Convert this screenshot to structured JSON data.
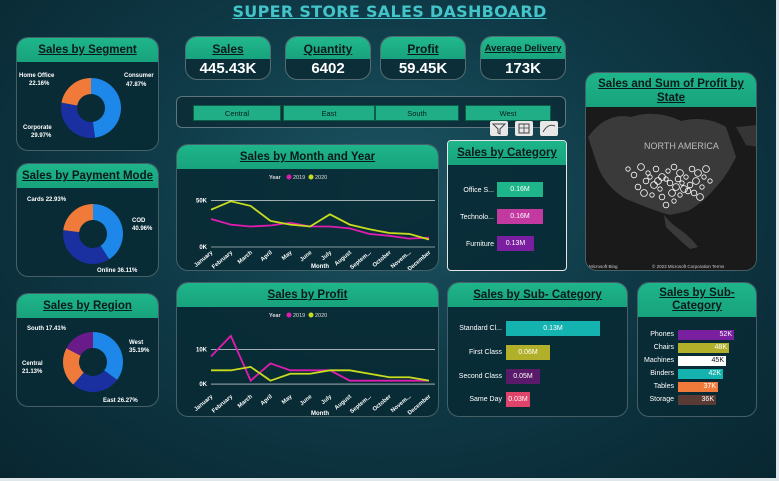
{
  "title": "SUPER STORE SALES DASHBOARD",
  "kpis": [
    {
      "label": "Sales",
      "value": "445.43K"
    },
    {
      "label": "Quantity",
      "value": "6402"
    },
    {
      "label": "Profit",
      "value": "59.45K"
    },
    {
      "label": "Average Delivery",
      "value": "173K"
    }
  ],
  "regions_slicer": [
    "Central",
    "East",
    "South",
    "West"
  ],
  "segment": {
    "title": "Sales by Segment",
    "slices": [
      {
        "name": "Consumer",
        "pct": "47.87%",
        "value": 47.87,
        "color": "#1e88ea"
      },
      {
        "name": "Corporate",
        "pct": "29.97%",
        "value": 29.97,
        "color": "#1a2fa0"
      },
      {
        "name": "Home Office",
        "pct": "22.16%",
        "value": 22.16,
        "color": "#f07a3a"
      }
    ]
  },
  "payment": {
    "title": "Sales by Payment Mode",
    "slices": [
      {
        "name": "COD",
        "pct": "40.96%",
        "value": 40.96,
        "color": "#1e88ea"
      },
      {
        "name": "Online",
        "pct": "36.11%",
        "value": 36.11,
        "color": "#1a2fa0"
      },
      {
        "name": "Cards",
        "pct": "22.93%",
        "value": 22.93,
        "color": "#f07a3a"
      }
    ]
  },
  "region": {
    "title": "Sales by Region",
    "slices": [
      {
        "name": "West",
        "pct": "35.19%",
        "value": 35.19,
        "color": "#1e88ea"
      },
      {
        "name": "East",
        "pct": "26.27%",
        "value": 26.27,
        "color": "#1a2fa0"
      },
      {
        "name": "Central",
        "pct": "21.13%",
        "value": 21.13,
        "color": "#f07a3a"
      },
      {
        "name": "South",
        "pct": "17.41%",
        "value": 17.41,
        "color": "#6a1b8a"
      }
    ]
  },
  "month_chart": {
    "title": "Sales by Month and Year",
    "xlabel": "Month",
    "legend_title": "Year",
    "ticks": [
      "0K",
      "50K"
    ]
  },
  "profit_chart": {
    "title": "Sales by Profit",
    "xlabel": "Month",
    "legend_title": "Year",
    "ticks": [
      "0K",
      "10K"
    ]
  },
  "chart_data": [
    {
      "type": "line",
      "title": "Sales by Month and Year",
      "xlabel": "Month",
      "categories": [
        "January",
        "February",
        "March",
        "April",
        "May",
        "June",
        "July",
        "August",
        "Septem...",
        "October",
        "Novem...",
        "December"
      ],
      "series": [
        {
          "name": "2019",
          "color": "#e01cb0",
          "values": [
            30,
            24,
            22,
            23,
            26,
            22,
            22,
            20,
            14,
            12,
            9,
            10
          ]
        },
        {
          "name": "2020",
          "color": "#c8dc1e",
          "values": [
            40,
            49,
            44,
            28,
            24,
            22,
            35,
            24,
            19,
            15,
            14,
            8
          ]
        }
      ],
      "ylim": [
        0,
        60
      ]
    },
    {
      "type": "line",
      "title": "Sales by Profit",
      "xlabel": "Month",
      "categories": [
        "January",
        "February",
        "March",
        "April",
        "May",
        "June",
        "July",
        "August",
        "Septem...",
        "October",
        "Novem...",
        "December"
      ],
      "series": [
        {
          "name": "2019",
          "color": "#e01cb0",
          "values": [
            8,
            14,
            1,
            6,
            4,
            4,
            4,
            1,
            1,
            1,
            1,
            1
          ]
        },
        {
          "name": "2020",
          "color": "#c8dc1e",
          "values": [
            4,
            4,
            5,
            1,
            3,
            3,
            4,
            4,
            3,
            2,
            2,
            1
          ]
        }
      ],
      "ylim": [
        -2,
        16
      ]
    },
    {
      "type": "bar",
      "title": "Sales by Category",
      "categories": [
        "Office S...",
        "Technolo...",
        "Furniture"
      ],
      "values": [
        0.16,
        0.16,
        0.13
      ],
      "labels": [
        "0.16M",
        "0.16M",
        "0.13M"
      ]
    },
    {
      "type": "bar",
      "title": "Sales by Sub- Category",
      "categories": [
        "Standard Cl...",
        "First Class",
        "Second Class",
        "Same Day"
      ],
      "values": [
        0.13,
        0.06,
        0.05,
        0.03
      ],
      "labels": [
        "0.13M",
        "0.06M",
        "0.05M",
        "0.03M"
      ]
    },
    {
      "type": "bar",
      "title": "Sales by Sub- Category",
      "categories": [
        "Phones",
        "Chairs",
        "Machines",
        "Binders",
        "Tables",
        "Storage"
      ],
      "values": [
        52,
        48,
        45,
        42,
        37,
        36
      ],
      "labels": [
        "52K",
        "48K",
        "45K",
        "42K",
        "37K",
        "36K"
      ]
    }
  ],
  "category": {
    "title": "Sales by Category",
    "bars": [
      {
        "label": "Office S...",
        "value": "0.16M",
        "color": "#1fb58a"
      },
      {
        "label": "Technolo...",
        "value": "0.16M",
        "color": "#c23aa0"
      },
      {
        "label": "Furniture",
        "value": "0.13M",
        "color": "#7a1fa0"
      }
    ]
  },
  "ship": {
    "title": "Sales by Sub- Category",
    "bars": [
      {
        "label": "Standard Cl...",
        "value": "0.13M",
        "color": "#14b3b0"
      },
      {
        "label": "First Class",
        "value": "0.06M",
        "color": "#b2b02a"
      },
      {
        "label": "Second Class",
        "value": "0.05M",
        "color": "#5a1a6a"
      },
      {
        "label": "Same Day",
        "value": "0.03M",
        "color": "#e0436a"
      }
    ]
  },
  "subcat": {
    "title": "Sales by Sub-Category",
    "bars": [
      {
        "label": "Phones",
        "value": "52K",
        "color": "#7a1fa0"
      },
      {
        "label": "Chairs",
        "value": "48K",
        "color": "#b2b02a"
      },
      {
        "label": "Machines",
        "value": "45K",
        "color": "#ffffff"
      },
      {
        "label": "Binders",
        "value": "42K",
        "color": "#14b3b0"
      },
      {
        "label": "Tables",
        "value": "37K",
        "color": "#f07a3a"
      },
      {
        "label": "Storage",
        "value": "36K",
        "color": "#5a3a34"
      }
    ]
  },
  "map": {
    "title": "Sales and Sum of Profit by State",
    "continent_label": "NORTH AMERICA",
    "attribution_left": "Microsoft Bing",
    "attribution_right": "© 2023 Microsoft Corporation  Terms"
  }
}
